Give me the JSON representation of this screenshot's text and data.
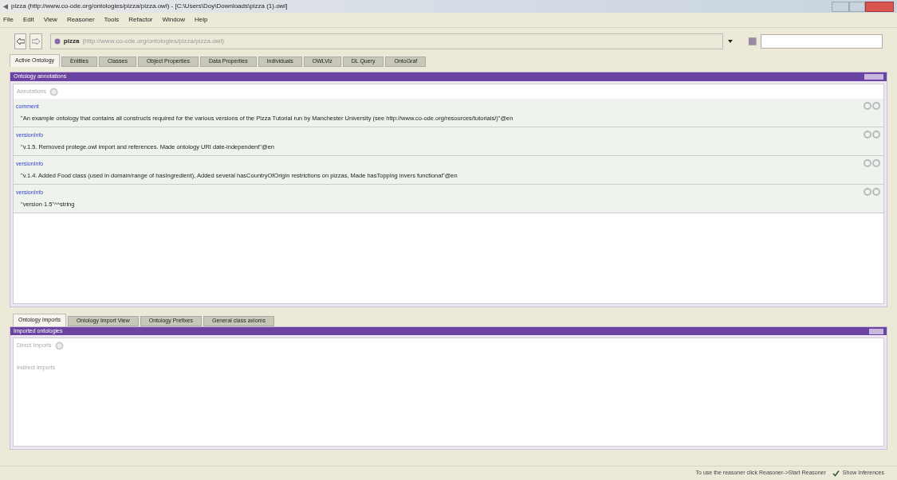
{
  "window": {
    "title": "pizza (http://www.co-ode.org/ontologies/pizza/pizza.owl) - [C:\\Users\\Doy\\Downloads\\pizza (1).owl]"
  },
  "menu": [
    "File",
    "Edit",
    "View",
    "Reasoner",
    "Tools",
    "Refactor",
    "Window",
    "Help"
  ],
  "address": {
    "name": "pizza",
    "iri": "(http://www.co-ode.org/ontologies/pizza/pizza.owl)"
  },
  "tabs": [
    {
      "label": "Active Ontology",
      "selected": true
    },
    {
      "label": "Entities",
      "selected": false
    },
    {
      "label": "Classes",
      "selected": false
    },
    {
      "label": "Object Properties",
      "selected": false
    },
    {
      "label": "Data Properties",
      "selected": false
    },
    {
      "label": "Individuals",
      "selected": false
    },
    {
      "label": "OWLViz",
      "selected": false
    },
    {
      "label": "DL Query",
      "selected": false
    },
    {
      "label": "OntoGraf",
      "selected": false
    }
  ],
  "annotations_panel": {
    "title": "Ontology annotations",
    "add_label": "Annotations",
    "rows": [
      {
        "property": "comment",
        "value": "\"An example ontology that contains all constructs required for the various versions of the Pizza Tutorial run by Manchester University (see http://www.co-ode.org/resources/tutorials/)\"@en"
      },
      {
        "property": "versionInfo",
        "value": "\"v.1.5. Removed protege.owl import and references. Made ontology URI date-independent\"@en"
      },
      {
        "property": "versionInfo",
        "value": "\"v.1.4. Added Food class (used in domain/range of hasIngredient), Added several hasCountryOfOrigin restrictions on pizzas, Made hasTopping invers functional\"@en"
      },
      {
        "property": "versionInfo",
        "value": "\"version 1.5\"^^string"
      }
    ]
  },
  "bottom_tabs": [
    {
      "label": "Ontology imports",
      "selected": true
    },
    {
      "label": "Ontology Import View",
      "selected": false
    },
    {
      "label": "Ontology Prefixes",
      "selected": false
    },
    {
      "label": "General class axioms",
      "selected": false
    }
  ],
  "imports_panel": {
    "title": "Imported ontologies",
    "direct_label": "Direct Imports",
    "indirect_label": "Indirect Imports"
  },
  "status_bar": {
    "message": "To use the reasoner click Reasoner->Start Reasoner",
    "show_inferences": {
      "label": "Show Inferences",
      "checked": true
    }
  }
}
